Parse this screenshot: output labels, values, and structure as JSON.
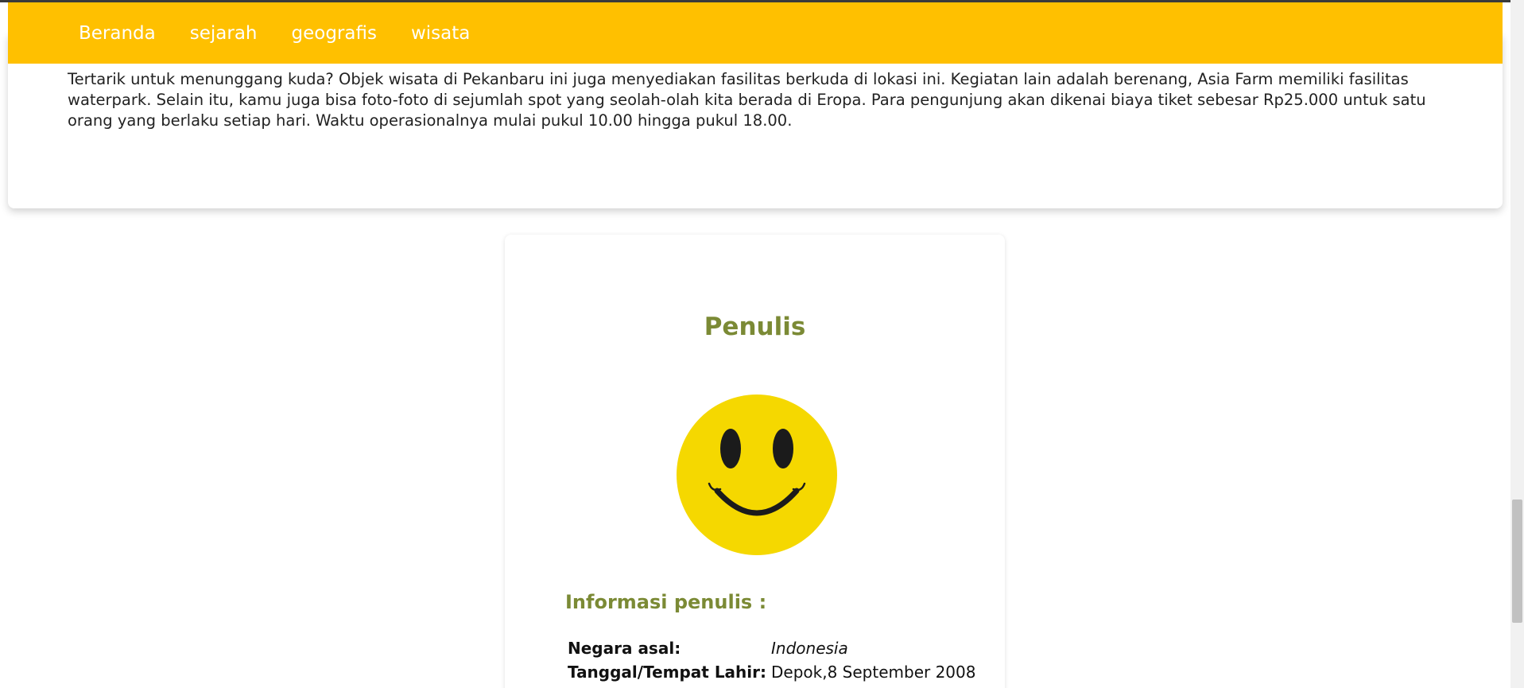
{
  "nav": {
    "links": [
      "Beranda",
      "sejarah",
      "geografis",
      "wisata"
    ]
  },
  "article": {
    "paragraph": "Tertarik untuk menunggang kuda? Objek wisata di Pekanbaru ini juga menyediakan fasilitas berkuda di lokasi ini. Kegiatan lain adalah berenang, Asia Farm memiliki fasilitas waterpark. Selain itu, kamu juga bisa foto-foto di sejumlah spot yang seolah-olah kita berada di Eropa. Para pengunjung akan dikenai biaya tiket sebesar Rp25.000 untuk satu orang yang berlaku setiap hari. Waktu operasionalnya mulai pukul 10.00 hingga pukul 18.00."
  },
  "author": {
    "title": "Penulis",
    "avatar_icon": "smiley-face-icon",
    "info_title": "Informasi penulis :",
    "rows": [
      {
        "label": "Negara asal:",
        "value": "Indonesia"
      },
      {
        "label": "Tanggal/Tempat Lahir:",
        "value": "Depok,8 September 2008"
      }
    ]
  },
  "colors": {
    "navbar": "#ffc000",
    "heading": "#7b8a35",
    "avatar_face": "#f5d800"
  }
}
